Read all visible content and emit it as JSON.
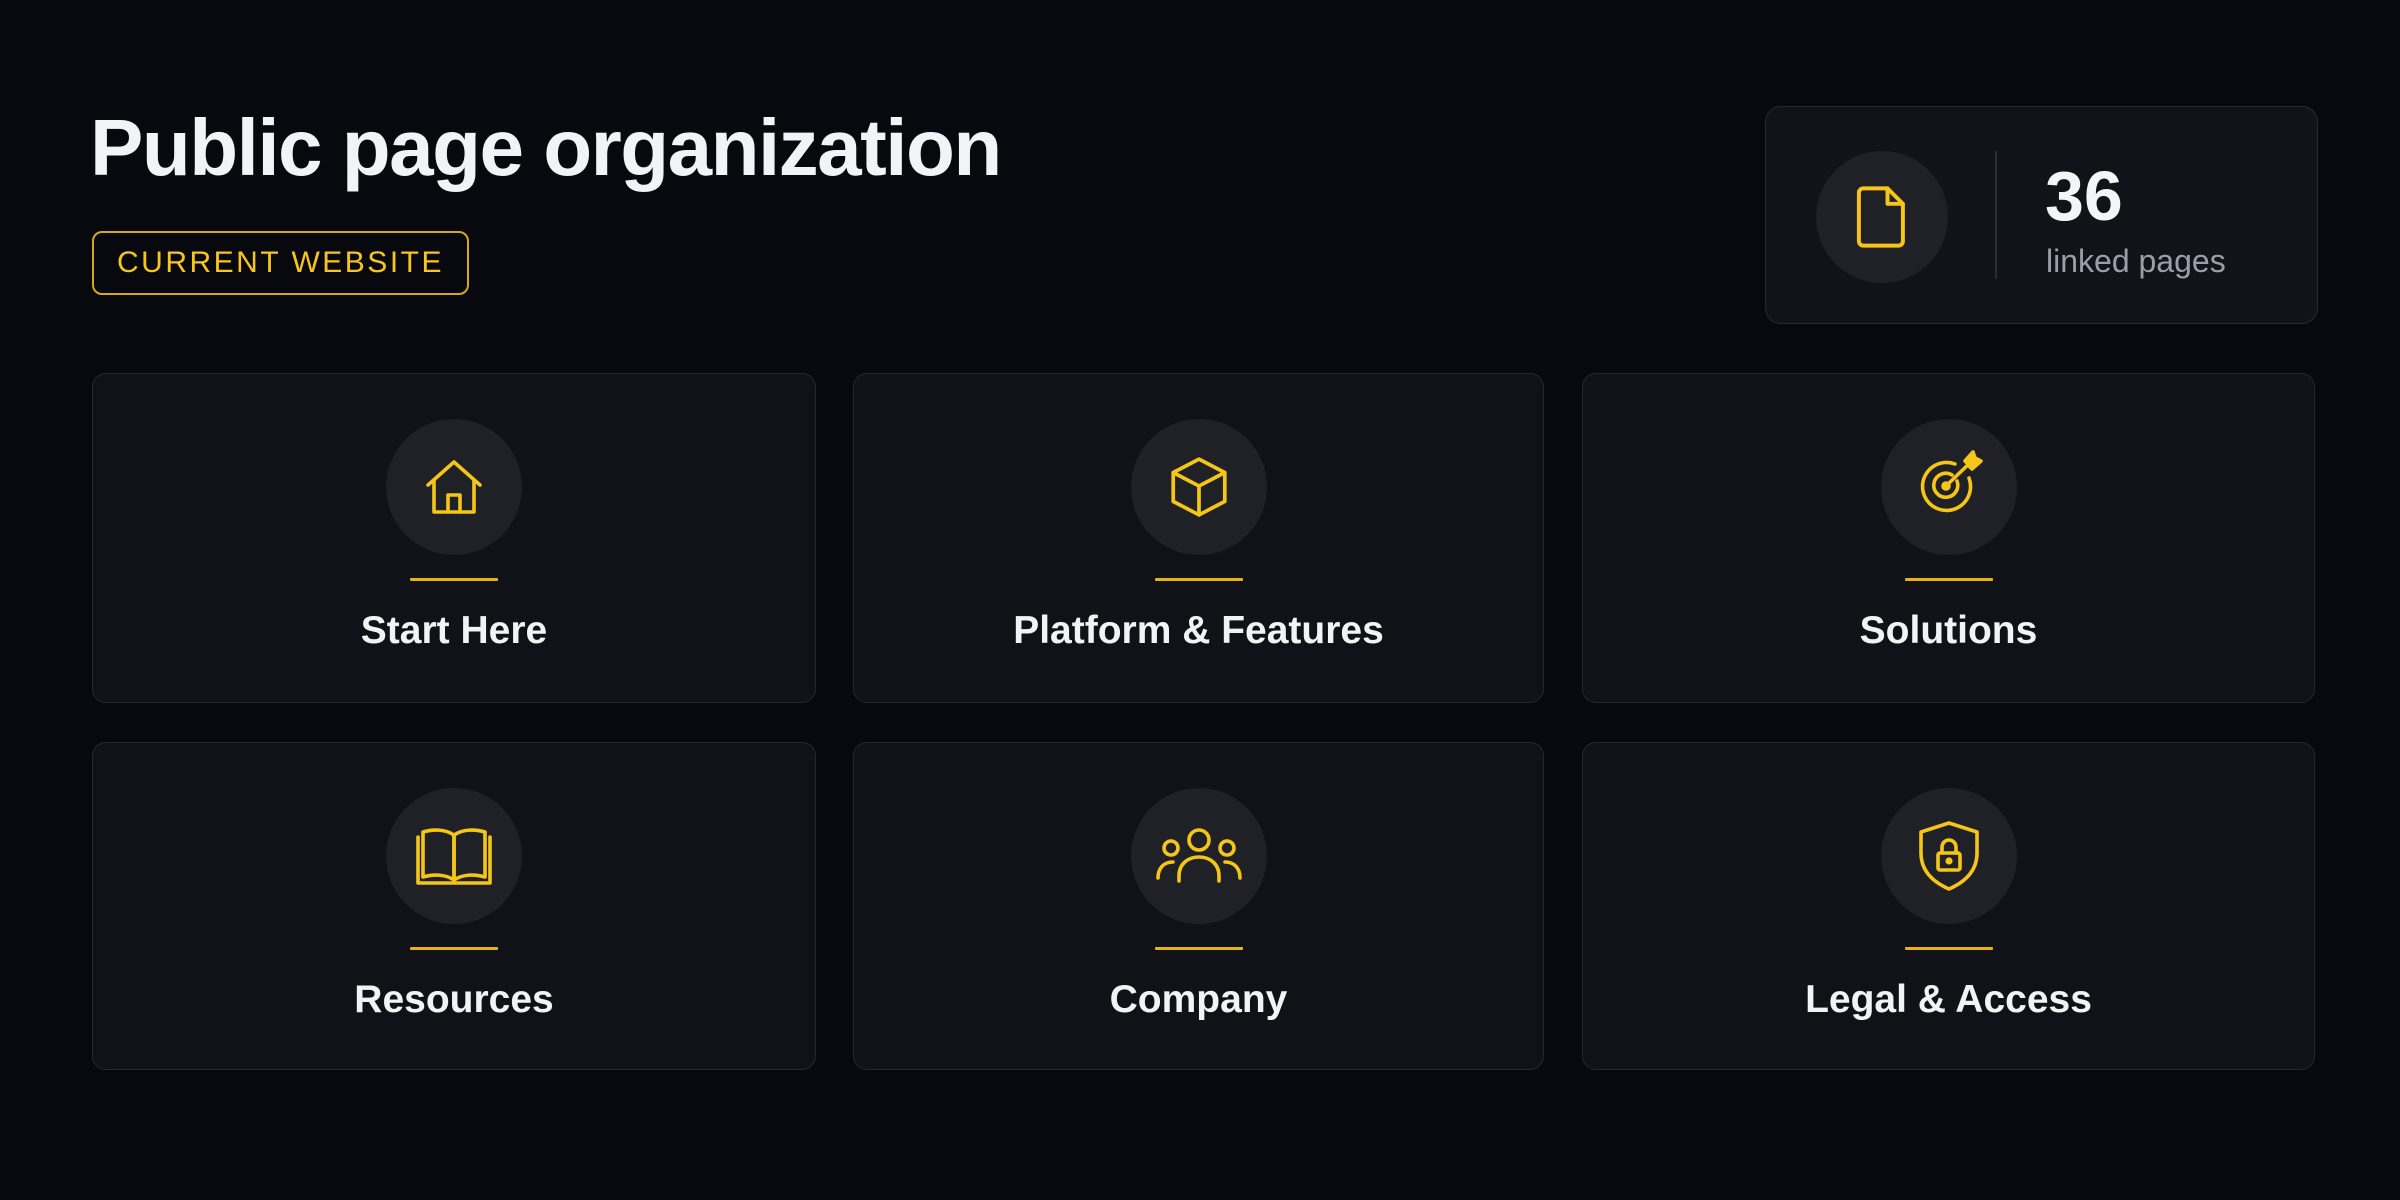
{
  "header": {
    "title": "Public page organization",
    "badge": "CURRENT WEBSITE"
  },
  "stat": {
    "icon": "file-icon",
    "value": "36",
    "label": "linked pages"
  },
  "sections": [
    {
      "label": "Start Here",
      "icon": "home-icon"
    },
    {
      "label": "Platform & Features",
      "icon": "box-icon"
    },
    {
      "label": "Solutions",
      "icon": "target-icon"
    },
    {
      "label": "Resources",
      "icon": "book-icon"
    },
    {
      "label": "Company",
      "icon": "users-icon"
    },
    {
      "label": "Legal & Access",
      "icon": "shield-lock-icon"
    }
  ],
  "colors": {
    "background": "#07090e",
    "card": "#101217",
    "accent": "#f5c518",
    "text": "#f2f3f5",
    "muted": "#9a9ea8"
  }
}
